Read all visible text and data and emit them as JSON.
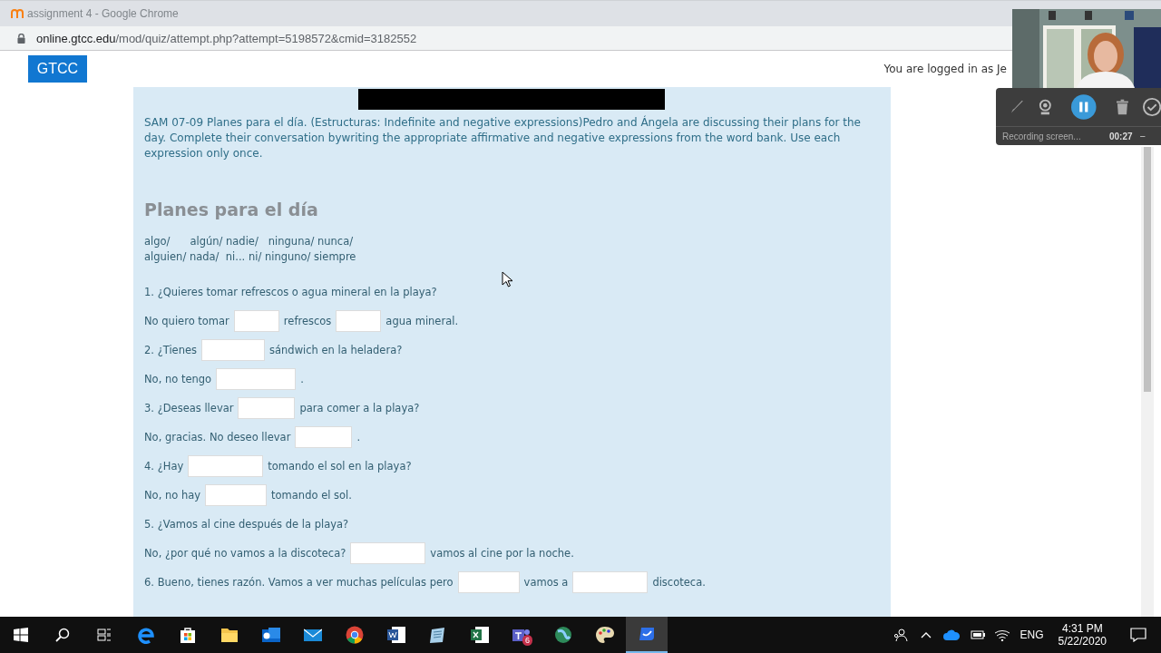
{
  "window": {
    "title": "assignment 4 - Google Chrome"
  },
  "address_bar": {
    "host": "online.gtcc.edu",
    "path": "/mod/quiz/attempt.php?attempt=5198572&cmid=3182552"
  },
  "header": {
    "brand": "GTCC",
    "login_text": "You are logged in as Je"
  },
  "question": {
    "intro": "SAM 07-09 Planes para el día. (Estructuras: Indefinite and negative expressions)Pedro and Ángela are discussing their plans for the day. Complete their conversation bywriting the appropriate affirmative and negative expressions from the word bank. Use each expression only once.",
    "heading": "Planes para el día",
    "word_bank": [
      "algo/      algún/ nadie/   ninguna/ nunca/",
      "alguien/ nada/  ni... ni/ ninguno/ siempre"
    ],
    "lines": [
      {
        "parts": [
          {
            "kind": "text",
            "text": "1. ¿Quieres tomar refrescos o agua mineral en la playa?"
          }
        ]
      },
      {
        "parts": [
          {
            "kind": "text",
            "text": "No quiero tomar"
          },
          {
            "kind": "blank"
          },
          {
            "kind": "text",
            "text": "refrescos"
          },
          {
            "kind": "blank"
          },
          {
            "kind": "text",
            "text": "agua mineral."
          }
        ]
      },
      {
        "parts": [
          {
            "kind": "text",
            "text": "2. ¿Tienes"
          },
          {
            "kind": "blank"
          },
          {
            "kind": "text",
            "text": "sándwich en la heladera?"
          }
        ]
      },
      {
        "parts": [
          {
            "kind": "text",
            "text": "No, no tengo"
          },
          {
            "kind": "blank"
          },
          {
            "kind": "text",
            "text": "."
          }
        ]
      },
      {
        "parts": [
          {
            "kind": "text",
            "text": "3. ¿Deseas llevar"
          },
          {
            "kind": "blank"
          },
          {
            "kind": "text",
            "text": "para comer a la playa?"
          }
        ]
      },
      {
        "parts": [
          {
            "kind": "text",
            "text": "No, gracias. No deseo llevar"
          },
          {
            "kind": "blank"
          },
          {
            "kind": "text",
            "text": "."
          }
        ]
      },
      {
        "parts": [
          {
            "kind": "text",
            "text": "4. ¿Hay"
          },
          {
            "kind": "blank"
          },
          {
            "kind": "text",
            "text": "tomando el sol en la playa?"
          }
        ]
      },
      {
        "parts": [
          {
            "kind": "text",
            "text": "No, no hay"
          },
          {
            "kind": "blank"
          },
          {
            "kind": "text",
            "text": "tomando el sol."
          }
        ]
      },
      {
        "parts": [
          {
            "kind": "text",
            "text": "5. ¿Vamos al cine después de la playa?"
          }
        ]
      },
      {
        "parts": [
          {
            "kind": "text",
            "text": "No, ¿por qué no vamos a la discoteca?"
          },
          {
            "kind": "blank"
          },
          {
            "kind": "text",
            "text": "vamos al cine por la noche."
          }
        ]
      },
      {
        "parts": [
          {
            "kind": "text",
            "text": "6. Bueno, tienes razón. Vamos a ver muchas películas pero"
          },
          {
            "kind": "blank"
          },
          {
            "kind": "text",
            "text": "vamos a"
          },
          {
            "kind": "blank"
          },
          {
            "kind": "text",
            "text": "discoteca."
          }
        ]
      }
    ]
  },
  "recorder": {
    "status": "Recording screen...",
    "elapsed": "00:27",
    "minimize": "−"
  },
  "taskbar": {
    "teams_badge": "6",
    "language": "ENG",
    "time": "4:31 PM",
    "date": "5/22/2020"
  }
}
